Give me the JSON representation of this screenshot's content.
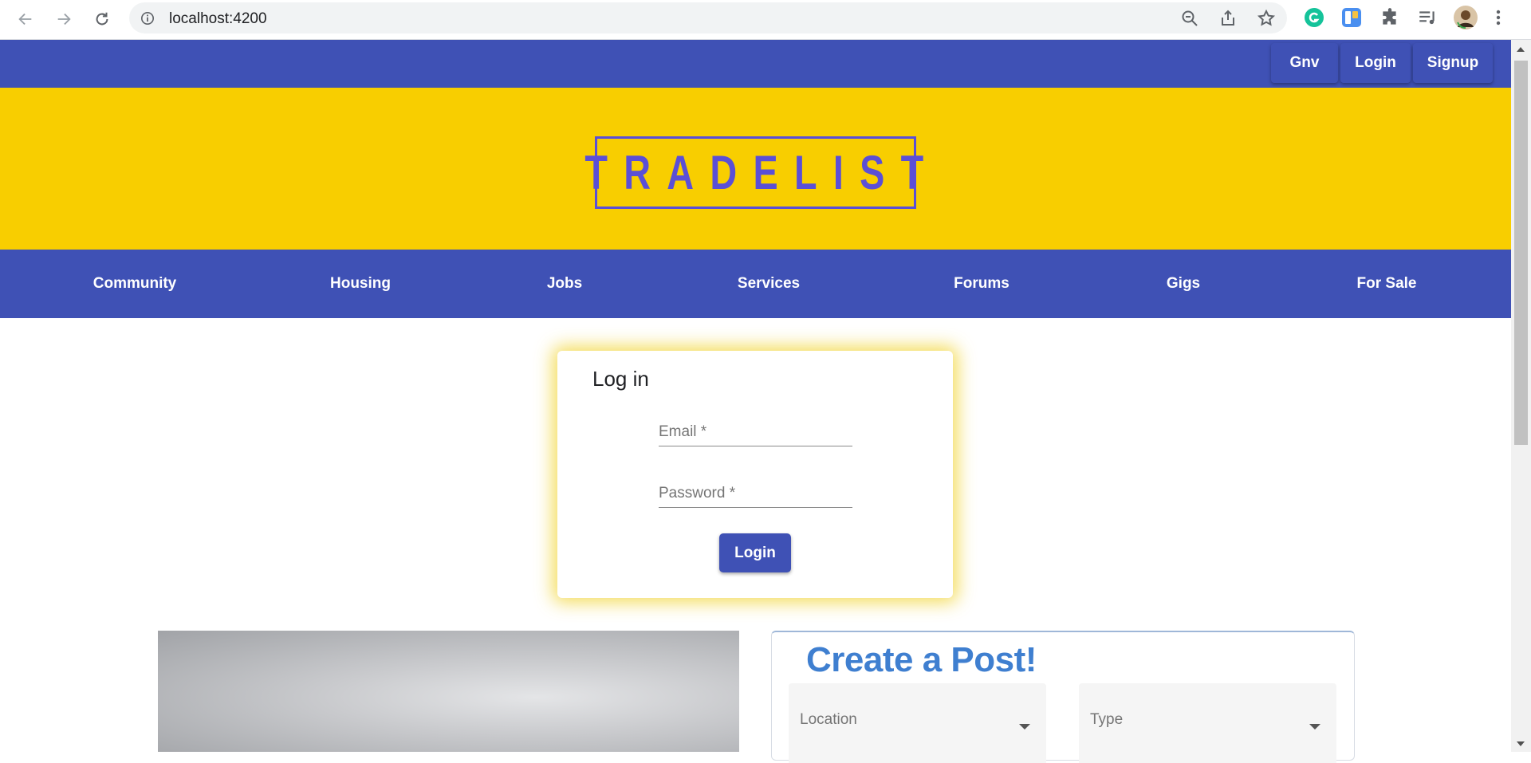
{
  "browser": {
    "url": "localhost:4200"
  },
  "topbar": {
    "buttons": [
      "Gnv",
      "Login",
      "Signup"
    ]
  },
  "banner": {
    "logo_text": "TRADELIST"
  },
  "categories": [
    "Community",
    "Housing",
    "Jobs",
    "Services",
    "Forums",
    "Gigs",
    "For Sale"
  ],
  "login": {
    "title": "Log in",
    "email_placeholder": "Email *",
    "password_placeholder": "Password *",
    "submit_label": "Login"
  },
  "create_post": {
    "title": "Create a Post!",
    "location_placeholder": "Location",
    "type_placeholder": "Type"
  },
  "colors": {
    "primary": "#3f51b5",
    "banner": "#f8ce00",
    "logo": "#5b4fd6",
    "post_title": "#3f7fd0"
  }
}
